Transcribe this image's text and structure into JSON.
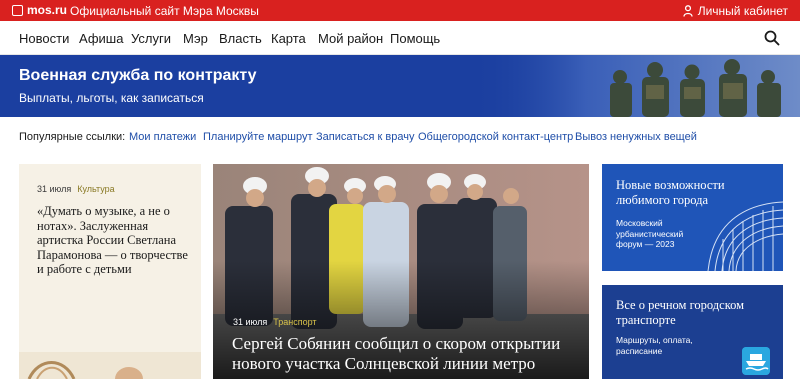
{
  "topbar": {
    "logo": "mos.ru",
    "site_title": "Официальный сайт Мэра Москвы",
    "cabinet": "Личный кабинет"
  },
  "nav": {
    "items": [
      "Новости",
      "Афиша",
      "Услуги",
      "Мэр",
      "Власть",
      "Карта",
      "Мой район",
      "Помощь"
    ]
  },
  "banner": {
    "title": "Военная служба по контракту",
    "subtitle": "Выплаты, льготы, как записаться"
  },
  "popular": {
    "label": "Популярные ссылки:",
    "links": [
      "Мои платежи",
      "Планируйте маршрут",
      "Записаться к врачу",
      "Общегородской контакт-центр",
      "Вывоз ненужных вещей"
    ]
  },
  "cards": {
    "culture": {
      "date": "31 июля",
      "tag": "Культура",
      "text": "«Думать о музыке, а не о нотах». Заслуженная артистка России Светлана Парамонова — о творчестве и работе с детьми"
    },
    "main": {
      "date": "31 июля",
      "tag": "Транспорт",
      "headline": "Сергей Собянин сообщил о скором открытии нового участка Солнцевской линии метро"
    },
    "forum": {
      "title": "Новые возможности любимого города",
      "subtitle": "Московский урбанистический форум — 2023"
    },
    "river": {
      "title": "Все о речном городском транспорте",
      "subtitle": "Маршруты, оплата, расписание"
    }
  },
  "colors": {
    "topbar_red": "#d9211f",
    "banner_blue": "#1b3fa0",
    "link_blue": "#1f4ea8",
    "culture_tag": "#8a7a26",
    "transport_tag": "#d8c24a"
  },
  "icons": {
    "logo": "mos-logo-icon",
    "cabinet": "person-icon",
    "search": "search-icon",
    "boat": "boat-icon"
  }
}
